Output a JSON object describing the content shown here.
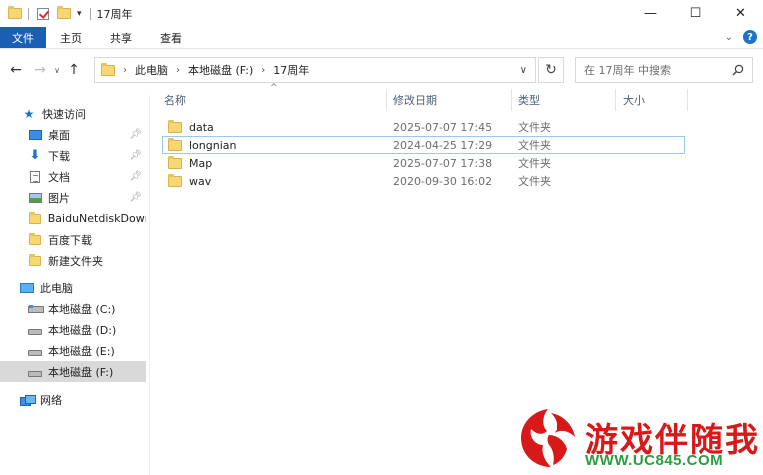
{
  "window": {
    "title": "17周年",
    "controls": {
      "minimize": "—",
      "maximize": "☐",
      "close": "✕"
    }
  },
  "ribbon": {
    "tabs": [
      "文件",
      "主页",
      "共享",
      "查看"
    ],
    "help": "?"
  },
  "address": {
    "breadcrumbs": [
      "此电脑",
      "本地磁盘 (F:)",
      "17周年"
    ],
    "search_placeholder": "在 17周年 中搜索"
  },
  "sidebar": {
    "quick_access": "快速访问",
    "quick_items": [
      {
        "label": "桌面",
        "icon": "desktop-icon",
        "pinned": true
      },
      {
        "label": "下载",
        "icon": "download-icon",
        "pinned": true
      },
      {
        "label": "文档",
        "icon": "document-icon",
        "pinned": true
      },
      {
        "label": "图片",
        "icon": "pictures-icon",
        "pinned": true
      },
      {
        "label": "BaiduNetdiskDownl",
        "icon": "folder-icon",
        "pinned": false
      },
      {
        "label": "百度下载",
        "icon": "folder-icon",
        "pinned": false
      },
      {
        "label": "新建文件夹",
        "icon": "folder-icon",
        "pinned": false
      }
    ],
    "this_pc": "此电脑",
    "drives": [
      "本地磁盘 (C:)",
      "本地磁盘 (D:)",
      "本地磁盘 (E:)",
      "本地磁盘 (F:)"
    ],
    "selected_drive": "本地磁盘 (F:)",
    "network": "网络"
  },
  "columns": {
    "name": "名称",
    "modified": "修改日期",
    "type": "类型",
    "size": "大小"
  },
  "files": [
    {
      "name": "data",
      "modified": "2025-07-07 17:45",
      "type": "文件夹"
    },
    {
      "name": "longnian",
      "modified": "2024-04-25 17:29",
      "type": "文件夹"
    },
    {
      "name": "Map",
      "modified": "2025-07-07 17:38",
      "type": "文件夹"
    },
    {
      "name": "wav",
      "modified": "2020-09-30 16:02",
      "type": "文件夹"
    }
  ],
  "focused_file": "longnian",
  "watermark": {
    "title": "游戏伴随我",
    "url": "WWW.UC845.COM"
  },
  "colors": {
    "accent": "#1a5fb4",
    "folder": "#f7d774",
    "selection": "#d9d9d9",
    "watermark_red": "#d7191a",
    "watermark_green": "#2b9c3e"
  }
}
